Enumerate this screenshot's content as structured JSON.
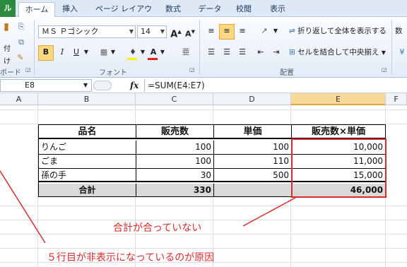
{
  "tabs": {
    "file": "ル",
    "home": "ホーム",
    "insert": "挿入",
    "layout": "ページ レイアウト",
    "formulas": "数式",
    "data": "データ",
    "review": "校閲",
    "view": "表示"
  },
  "ribbon": {
    "paste_fragment": "付け",
    "clipboard_label": "ボード",
    "font_name": "ＭＳ Ｐゴシック",
    "font_size": "14",
    "grow_font": "A",
    "shrink_font": "A",
    "bold": "B",
    "italic": "I",
    "underline": "U",
    "font_color_letter": "A",
    "font_group_label": "フォント",
    "wrap_text": "折り返して全体を表示する",
    "merge_center": "セルを結合して中央揃え",
    "alignment_label": "配置",
    "number_fragment": "数値"
  },
  "formula_bar": {
    "name_box": "E8",
    "fx": "fx",
    "formula": "=SUM(E4:E7)"
  },
  "columns": [
    "A",
    "B",
    "C",
    "D",
    "E",
    "F"
  ],
  "table": {
    "headers": [
      "品名",
      "販売数",
      "単価",
      "販売数×単価"
    ],
    "rows": [
      {
        "name": "りんご",
        "qty": "100",
        "price": "100",
        "total": "10,000"
      },
      {
        "name": "ごま",
        "qty": "100",
        "price": "110",
        "total": "11,000"
      },
      {
        "name": "孫の手",
        "qty": "30",
        "price": "500",
        "total": "15,000"
      }
    ],
    "total_row": {
      "label": "合計",
      "qty": "330",
      "total": "46,000"
    }
  },
  "annotations": {
    "mismatch": "合計が合っていない",
    "hidden_row": "５行目が非表示になっているのが原因"
  },
  "colors": {
    "annotation_red": "#d92b2b",
    "selected_col": "#f9d99a",
    "total_fill": "#d9d9d9"
  }
}
